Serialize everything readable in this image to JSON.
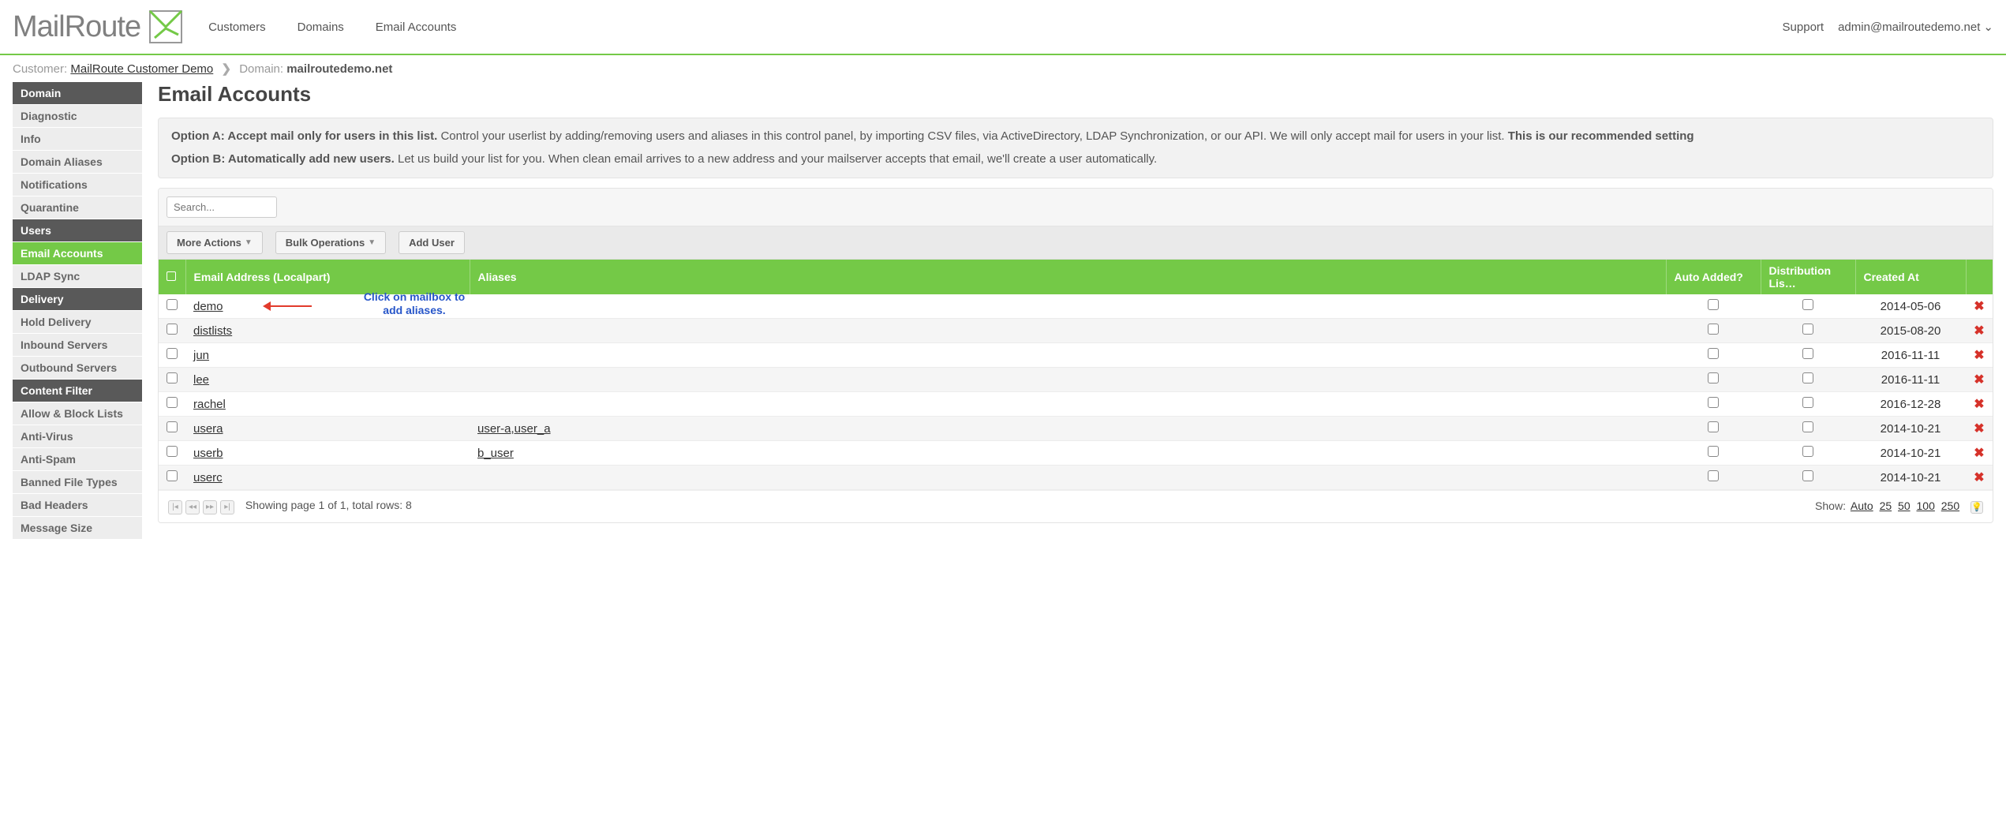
{
  "logo_text": "MailRoute",
  "topnav": {
    "customers": "Customers",
    "domains": "Domains",
    "email_accounts": "Email Accounts"
  },
  "header_right": {
    "support": "Support",
    "user": "admin@mailroutedemo.net"
  },
  "breadcrumb": {
    "customer_label": "Customer:",
    "customer_value": "MailRoute Customer Demo",
    "domain_label": "Domain:",
    "domain_value": "mailroutedemo.net"
  },
  "sidebar": {
    "items": [
      {
        "label": "Domain",
        "kind": "header"
      },
      {
        "label": "Diagnostic",
        "kind": "item"
      },
      {
        "label": "Info",
        "kind": "item"
      },
      {
        "label": "Domain Aliases",
        "kind": "item"
      },
      {
        "label": "Notifications",
        "kind": "item"
      },
      {
        "label": "Quarantine",
        "kind": "item"
      },
      {
        "label": "Users",
        "kind": "header"
      },
      {
        "label": "Email Accounts",
        "kind": "active"
      },
      {
        "label": "LDAP Sync",
        "kind": "item"
      },
      {
        "label": "Delivery",
        "kind": "header"
      },
      {
        "label": "Hold Delivery",
        "kind": "item"
      },
      {
        "label": "Inbound Servers",
        "kind": "item"
      },
      {
        "label": "Outbound Servers",
        "kind": "item"
      },
      {
        "label": "Content Filter",
        "kind": "header"
      },
      {
        "label": "Allow & Block Lists",
        "kind": "item"
      },
      {
        "label": "Anti-Virus",
        "kind": "item"
      },
      {
        "label": "Anti-Spam",
        "kind": "item"
      },
      {
        "label": "Banned File Types",
        "kind": "item"
      },
      {
        "label": "Bad Headers",
        "kind": "item"
      },
      {
        "label": "Message Size",
        "kind": "item"
      }
    ]
  },
  "page_title": "Email Accounts",
  "infobox": {
    "optA_title": "Option A: Accept mail only for users in this list.",
    "optA_body": " Control your userlist by adding/removing users and aliases in this control panel, by importing CSV files, via ActiveDirectory, LDAP Synchronization, or our API. We will only accept mail for users in your list. ",
    "optA_rec": "This is our recommended setting",
    "optB_title": "Option B: Automatically add new users.",
    "optB_body": " Let us build your list for you. When clean email arrives to a new address and your mailserver accepts that email, we'll create a user automatically."
  },
  "search_placeholder": "Search...",
  "actions": {
    "more": "More Actions",
    "bulk": "Bulk Operations",
    "add": "Add User"
  },
  "columns": {
    "email": "Email Address (Localpart)",
    "aliases": "Aliases",
    "auto": "Auto Added?",
    "dist": "Distribution Lis…",
    "created": "Created At"
  },
  "rows": [
    {
      "email": "demo",
      "aliases": "",
      "created": "2014-05-06"
    },
    {
      "email": "distlists",
      "aliases": "",
      "created": "2015-08-20"
    },
    {
      "email": "jun",
      "aliases": "",
      "created": "2016-11-11"
    },
    {
      "email": "lee",
      "aliases": "",
      "created": "2016-11-11"
    },
    {
      "email": "rachel",
      "aliases": "",
      "created": "2016-12-28"
    },
    {
      "email": "usera",
      "aliases": "user-a,user_a",
      "created": "2014-10-21"
    },
    {
      "email": "userb",
      "aliases": "b_user",
      "created": "2014-10-21"
    },
    {
      "email": "userc",
      "aliases": "",
      "created": "2014-10-21"
    }
  ],
  "annotation": "Click on mailbox to add aliases.",
  "footer": {
    "paging_text": "Showing page 1 of 1, total rows: 8",
    "show_label": "Show:",
    "options": [
      "Auto",
      "25",
      "50",
      "100",
      "250"
    ]
  }
}
